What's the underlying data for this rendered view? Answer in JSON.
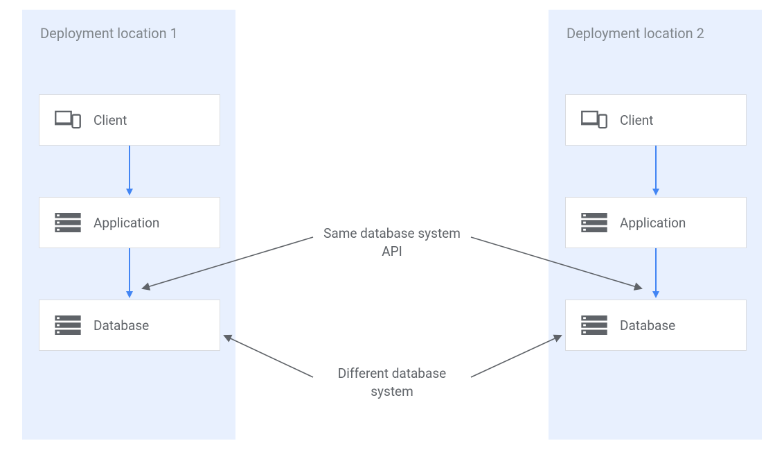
{
  "regions": {
    "left": {
      "title": "Deployment location 1"
    },
    "right": {
      "title": "Deployment location 2"
    }
  },
  "nodes": {
    "client": "Client",
    "application": "Application",
    "database": "Database"
  },
  "annotations": {
    "same_api": "Same database system API",
    "diff_db": "Different database system"
  },
  "colors": {
    "region_bg": "#e8f0fe",
    "node_border": "#dadce0",
    "text": "#5f6368",
    "arrow_blue": "#4285f4",
    "arrow_gray": "#5f6368"
  }
}
